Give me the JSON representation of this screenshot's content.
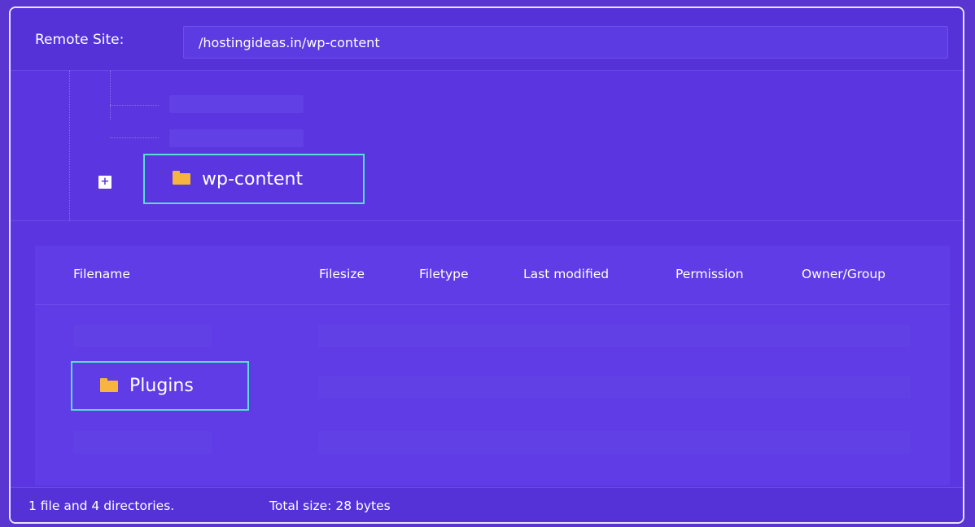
{
  "remote_site": {
    "label": "Remote Site:",
    "path": "/hostingideas.in/wp-content"
  },
  "tree": {
    "expand_symbol": "+",
    "selected_folder": "wp-content",
    "folder_icon": "folder-icon"
  },
  "file_list": {
    "columns": [
      "Filename",
      "Filesize",
      "Filetype",
      "Last modified",
      "Permission",
      "Owner/Group"
    ],
    "selected_item": "Plugins",
    "folder_icon": "folder-icon"
  },
  "status": {
    "summary": "1 file and 4 directories.",
    "total_size": "Total size: 28 bytes"
  },
  "colors": {
    "background": "#5a35e0",
    "highlight": "#56e0d3",
    "folder": "#f7b53f",
    "text": "#ffffff"
  }
}
